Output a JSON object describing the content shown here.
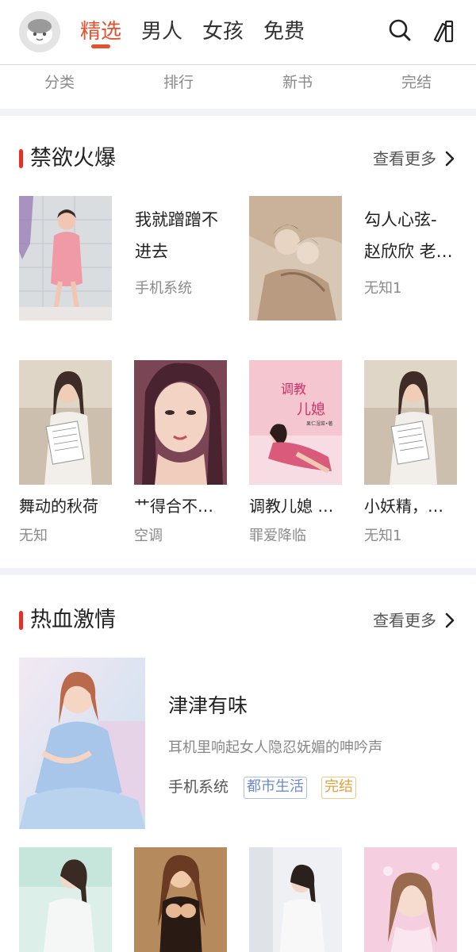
{
  "tabs": [
    {
      "label": "精选",
      "active": true
    },
    {
      "label": "男人",
      "active": false
    },
    {
      "label": "女孩",
      "active": false
    },
    {
      "label": "免费",
      "active": false
    }
  ],
  "header_icons": [
    "search-icon",
    "bookshelf-icon"
  ],
  "subnav": [
    "分类",
    "排行",
    "新书",
    "完结"
  ],
  "section1": {
    "title": "禁欲火爆",
    "more": "查看更多",
    "horizontal": [
      {
        "title_line1": "我就蹭蹭不",
        "title_line2": "进去",
        "author": "手机系统"
      },
      {
        "title_line1": "勾人心弦-",
        "title_line2": "赵欣欣 老…",
        "author": "无知1"
      }
    ],
    "grid": [
      {
        "title": "舞动的秋荷",
        "author": "无知"
      },
      {
        "title": "艹得合不…",
        "author": "空调"
      },
      {
        "title": "调教儿媳 …",
        "author": "罪爱降临",
        "cover_text_1": "调教",
        "cover_text_2": "儿媳",
        "cover_text_3": "果仁湿菜•著"
      },
      {
        "title": "小妖精，…",
        "author": "无知1"
      }
    ]
  },
  "section2": {
    "title": "热血激情",
    "more": "查看更多",
    "featured": {
      "title": "津津有味",
      "desc": "耳机里响起女人隐忍妩媚的呻吟声",
      "author": "手机系统",
      "tag_category": "都市生活",
      "tag_status": "完结"
    }
  },
  "colors": {
    "accent": "#e5512f",
    "section_bar": "#e5302a",
    "tag_blue": "#6d8ad0",
    "tag_orange": "#e0a13c"
  }
}
